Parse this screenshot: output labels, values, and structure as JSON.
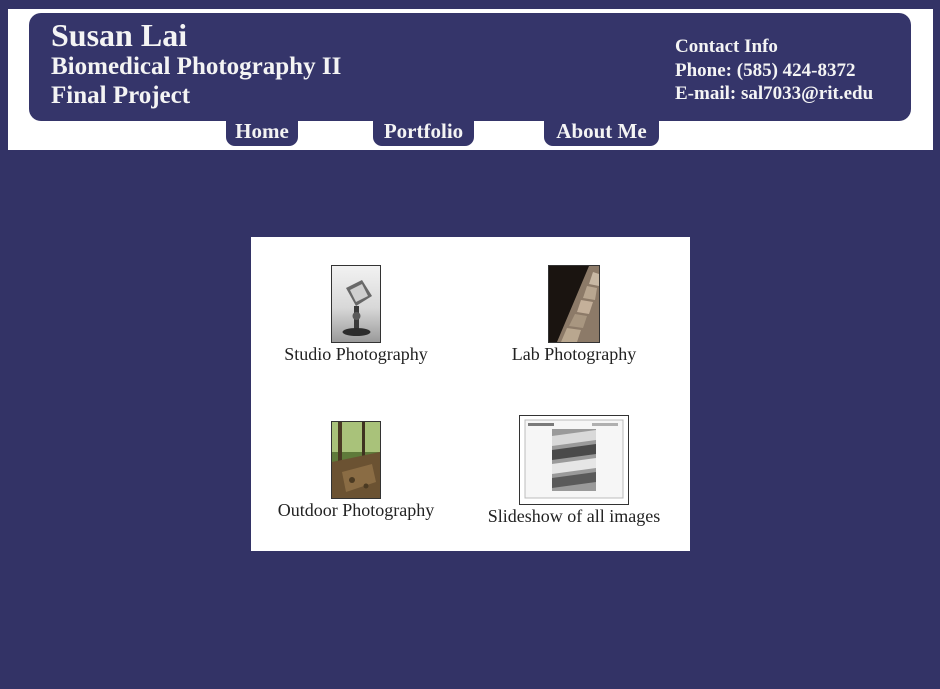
{
  "header": {
    "name": "Susan Lai",
    "subtitle": "Biomedical Photography II",
    "project": "Final Project",
    "contact_heading": "Contact Info",
    "phone": "Phone: (585) 424-8372",
    "email": "E-mail: sal7033@rit.edu"
  },
  "nav": {
    "home": "Home",
    "portfolio": "Portfolio",
    "about": "About Me"
  },
  "gallery": {
    "items": [
      {
        "label": "Studio Photography",
        "icon": "glass-sculpture-thumbnail"
      },
      {
        "label": "Lab Photography",
        "icon": "spine-specimen-thumbnail"
      },
      {
        "label": "Outdoor Photography",
        "icon": "forest-trail-thumbnail"
      },
      {
        "label": "Slideshow of all images",
        "icon": "slideshow-preview-thumbnail"
      }
    ]
  },
  "colors": {
    "background": "#333366",
    "banner": "#35356a",
    "text_light": "#f4f4f4"
  }
}
